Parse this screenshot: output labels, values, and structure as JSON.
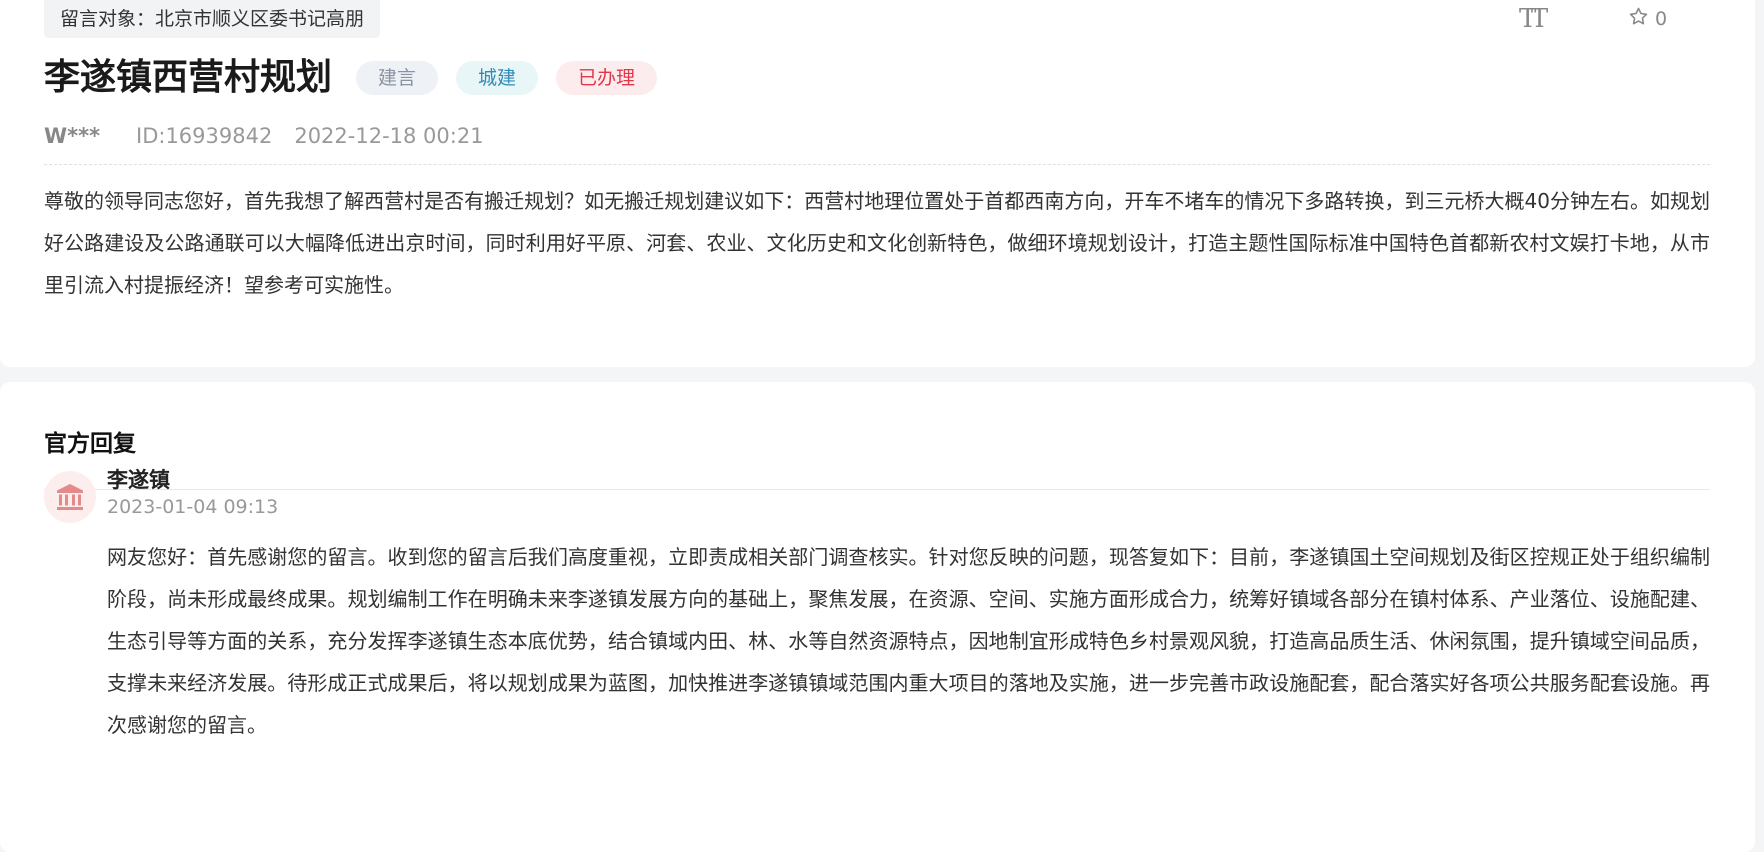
{
  "message": {
    "target_label": "留言对象：北京市顺义区委书记高朋",
    "font_size_icon": "text-size-icon",
    "font_size_glyph": "TT",
    "favorite": {
      "icon": "star-icon",
      "count": "0"
    },
    "title": "李遂镇西营村规划",
    "tags": {
      "type": "建言",
      "category": "城建",
      "status": "已办理"
    },
    "meta": {
      "user": "W***",
      "id": "ID:16939842",
      "time": "2022-12-18 00:21"
    },
    "body": "尊敬的领导同志您好，首先我想了解西营村是否有搬迁规划？如无搬迁规划建议如下：西营村地理位置处于首都西南方向，开车不堵车的情况下多路转换，到三元桥大概40分钟左右。如规划好公路建设及公路通联可以大幅降低进出京时间，同时利用好平原、河套、农业、文化历史和文化创新特色，做细环境规划设计，打造主题性国际标准中国特色首都新农村文娱打卡地，从市里引流入村提振经济！望参考可实施性。"
  },
  "reply": {
    "heading": "官方回复",
    "avatar_icon": "government-building-icon",
    "org_name": "李遂镇",
    "time": "2023-01-04 09:13",
    "text": "网友您好：首先感谢您的留言。收到您的留言后我们高度重视，立即责成相关部门调查核实。针对您反映的问题，现答复如下：目前，李遂镇国土空间规划及街区控规正处于组织编制阶段，尚未形成最终成果。规划编制工作在明确未来李遂镇发展方向的基础上，聚焦发展，在资源、空间、实施方面形成合力，统筹好镇域各部分在镇村体系、产业落位、设施配建、生态引导等方面的关系，充分发挥李遂镇生态本底优势，结合镇域内田、林、水等自然资源特点，因地制宜形成特色乡村景观风貌，打造高品质生活、休闲氛围，提升镇域空间品质，支撑未来经济发展。待形成正式成果后，将以规划成果为蓝图，加快推进李遂镇镇域范围内重大项目的落地及实施，进一步完善市政设施配套，配合落实好各项公共服务配套设施。再次感谢您的留言。"
  },
  "colors": {
    "status_tag": "#e0384a",
    "category_tag": "#2f8db7",
    "avatar_bg": "#fdeeee",
    "avatar_icon": "#e58a8a"
  }
}
